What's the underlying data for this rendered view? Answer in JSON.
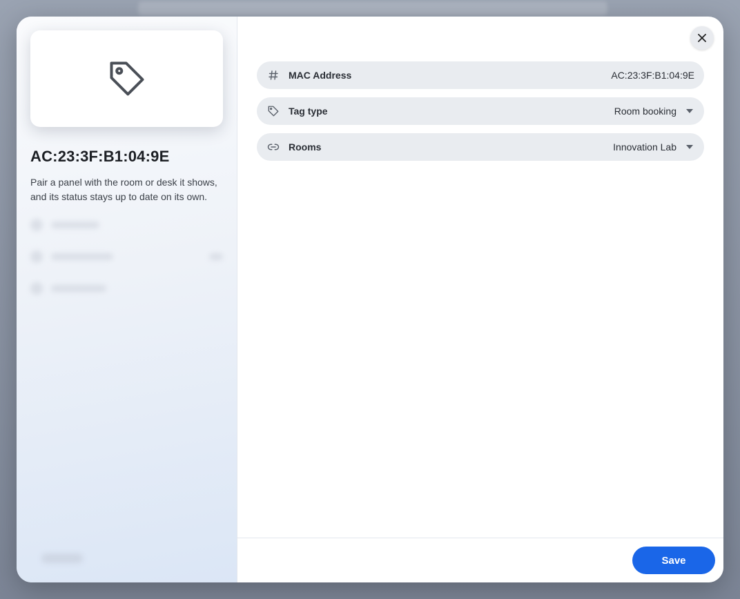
{
  "device": {
    "title": "AC:23:3F:B1:04:9E",
    "description": "Pair a panel with the room or desk it shows, and its status stays up to date on its own.",
    "hero_icon": "tag-icon"
  },
  "fields": {
    "mac": {
      "label": "MAC Address",
      "value": "AC:23:3F:B1:04:9E",
      "icon": "hash-icon"
    },
    "tag_type": {
      "label": "Tag type",
      "value": "Room booking",
      "icon": "tag-icon"
    },
    "rooms": {
      "label": "Rooms",
      "value": "Innovation Lab",
      "icon": "link-icon"
    }
  },
  "footer": {
    "save_label": "Save"
  },
  "colors": {
    "accent": "#1a66e8",
    "field_bg": "#e9ecf0"
  }
}
